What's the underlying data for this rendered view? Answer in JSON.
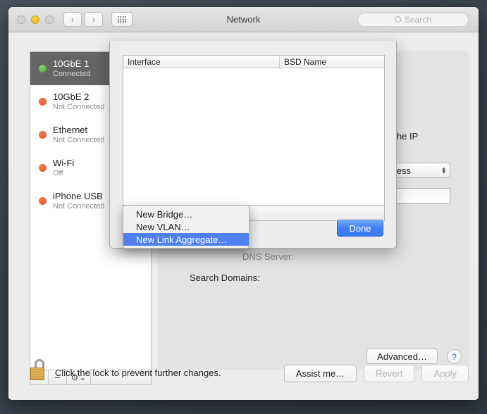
{
  "window": {
    "title": "Network",
    "traffic_lights": [
      "close-button",
      "minimize-button",
      "zoom-button"
    ],
    "nav_back": "‹",
    "nav_forward": "›",
    "grid_icon": "grid-icon",
    "search": {
      "placeholder": "Search",
      "icon": "search-icon"
    }
  },
  "sidebar": {
    "services": [
      {
        "name": "10GbE 1",
        "status": "Connected",
        "dot": "green",
        "selected": true
      },
      {
        "name": "10GbE 2",
        "status": "Not Connected",
        "dot": "red",
        "selected": false
      },
      {
        "name": "Ethernet",
        "status": "Not Connected",
        "dot": "red",
        "selected": false
      },
      {
        "name": "Wi-Fi",
        "status": "Off",
        "dot": "red",
        "selected": false
      },
      {
        "name": "iPhone USB",
        "status": "Not Connected",
        "dot": "red",
        "selected": false
      }
    ],
    "footer": {
      "add": "+",
      "remove": "−",
      "gear": "⚙",
      "gear_chevron": "⌄"
    }
  },
  "detail": {
    "partial_text_ip": "as the IP",
    "popup_value": "ddress",
    "stepper_up": "▴",
    "stepper_down": "▾",
    "dns_label_partial": "DNS Server:",
    "search_domains_label": "Search Domains:",
    "advanced_button": "Advanced…",
    "help_button": "?"
  },
  "sheet": {
    "table": {
      "columns": [
        "Interface",
        "BSD Name"
      ],
      "rows": []
    },
    "toolbar": {
      "add": "+",
      "remove": "−",
      "edit": "✎"
    },
    "done_button": "Done"
  },
  "menu": {
    "items": [
      {
        "label": "New Bridge…",
        "highlighted": false
      },
      {
        "label": "New VLAN…",
        "highlighted": false
      },
      {
        "label": "New Link Aggregate…",
        "highlighted": true
      }
    ]
  },
  "bottom": {
    "lock_icon": "unlocked-padlock-icon",
    "lock_text": "Click the lock to prevent further changes.",
    "assist_button": "Assist me…",
    "revert_button": "Revert",
    "apply_button": "Apply"
  },
  "colors": {
    "selection_blue": "#4e80f0",
    "default_button_blue": "#3f7ef4",
    "connected_green": "#43ab32",
    "disconnected_red": "#e05025",
    "sidebar_selected": "#646464",
    "desktop": "#3b434d"
  }
}
